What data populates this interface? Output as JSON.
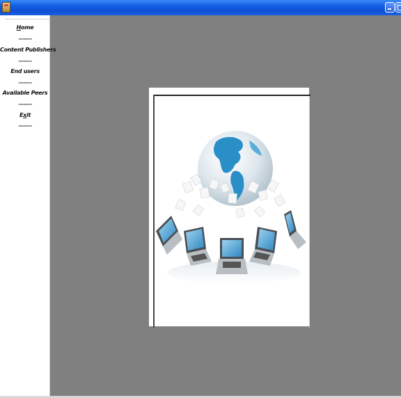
{
  "nav": {
    "items": [
      {
        "label": "Home",
        "accel": "H",
        "rest": "ome"
      },
      {
        "label": "Content Publishers"
      },
      {
        "label": "End users"
      },
      {
        "label": "Available Peers"
      },
      {
        "label": "Exit",
        "pre": "E",
        "accel": "x",
        "rest": "it"
      }
    ],
    "separator": "--------"
  },
  "colors": {
    "titlebar": "#0d4fd6",
    "workspace": "#808080",
    "globe_blue": "#2a8fc7",
    "sidebar": "#ffffff"
  },
  "icons": {
    "app": "java-cup-icon",
    "minimize": "minimize-icon",
    "restore": "restore-icon",
    "picture": "globe-network-illustration"
  }
}
